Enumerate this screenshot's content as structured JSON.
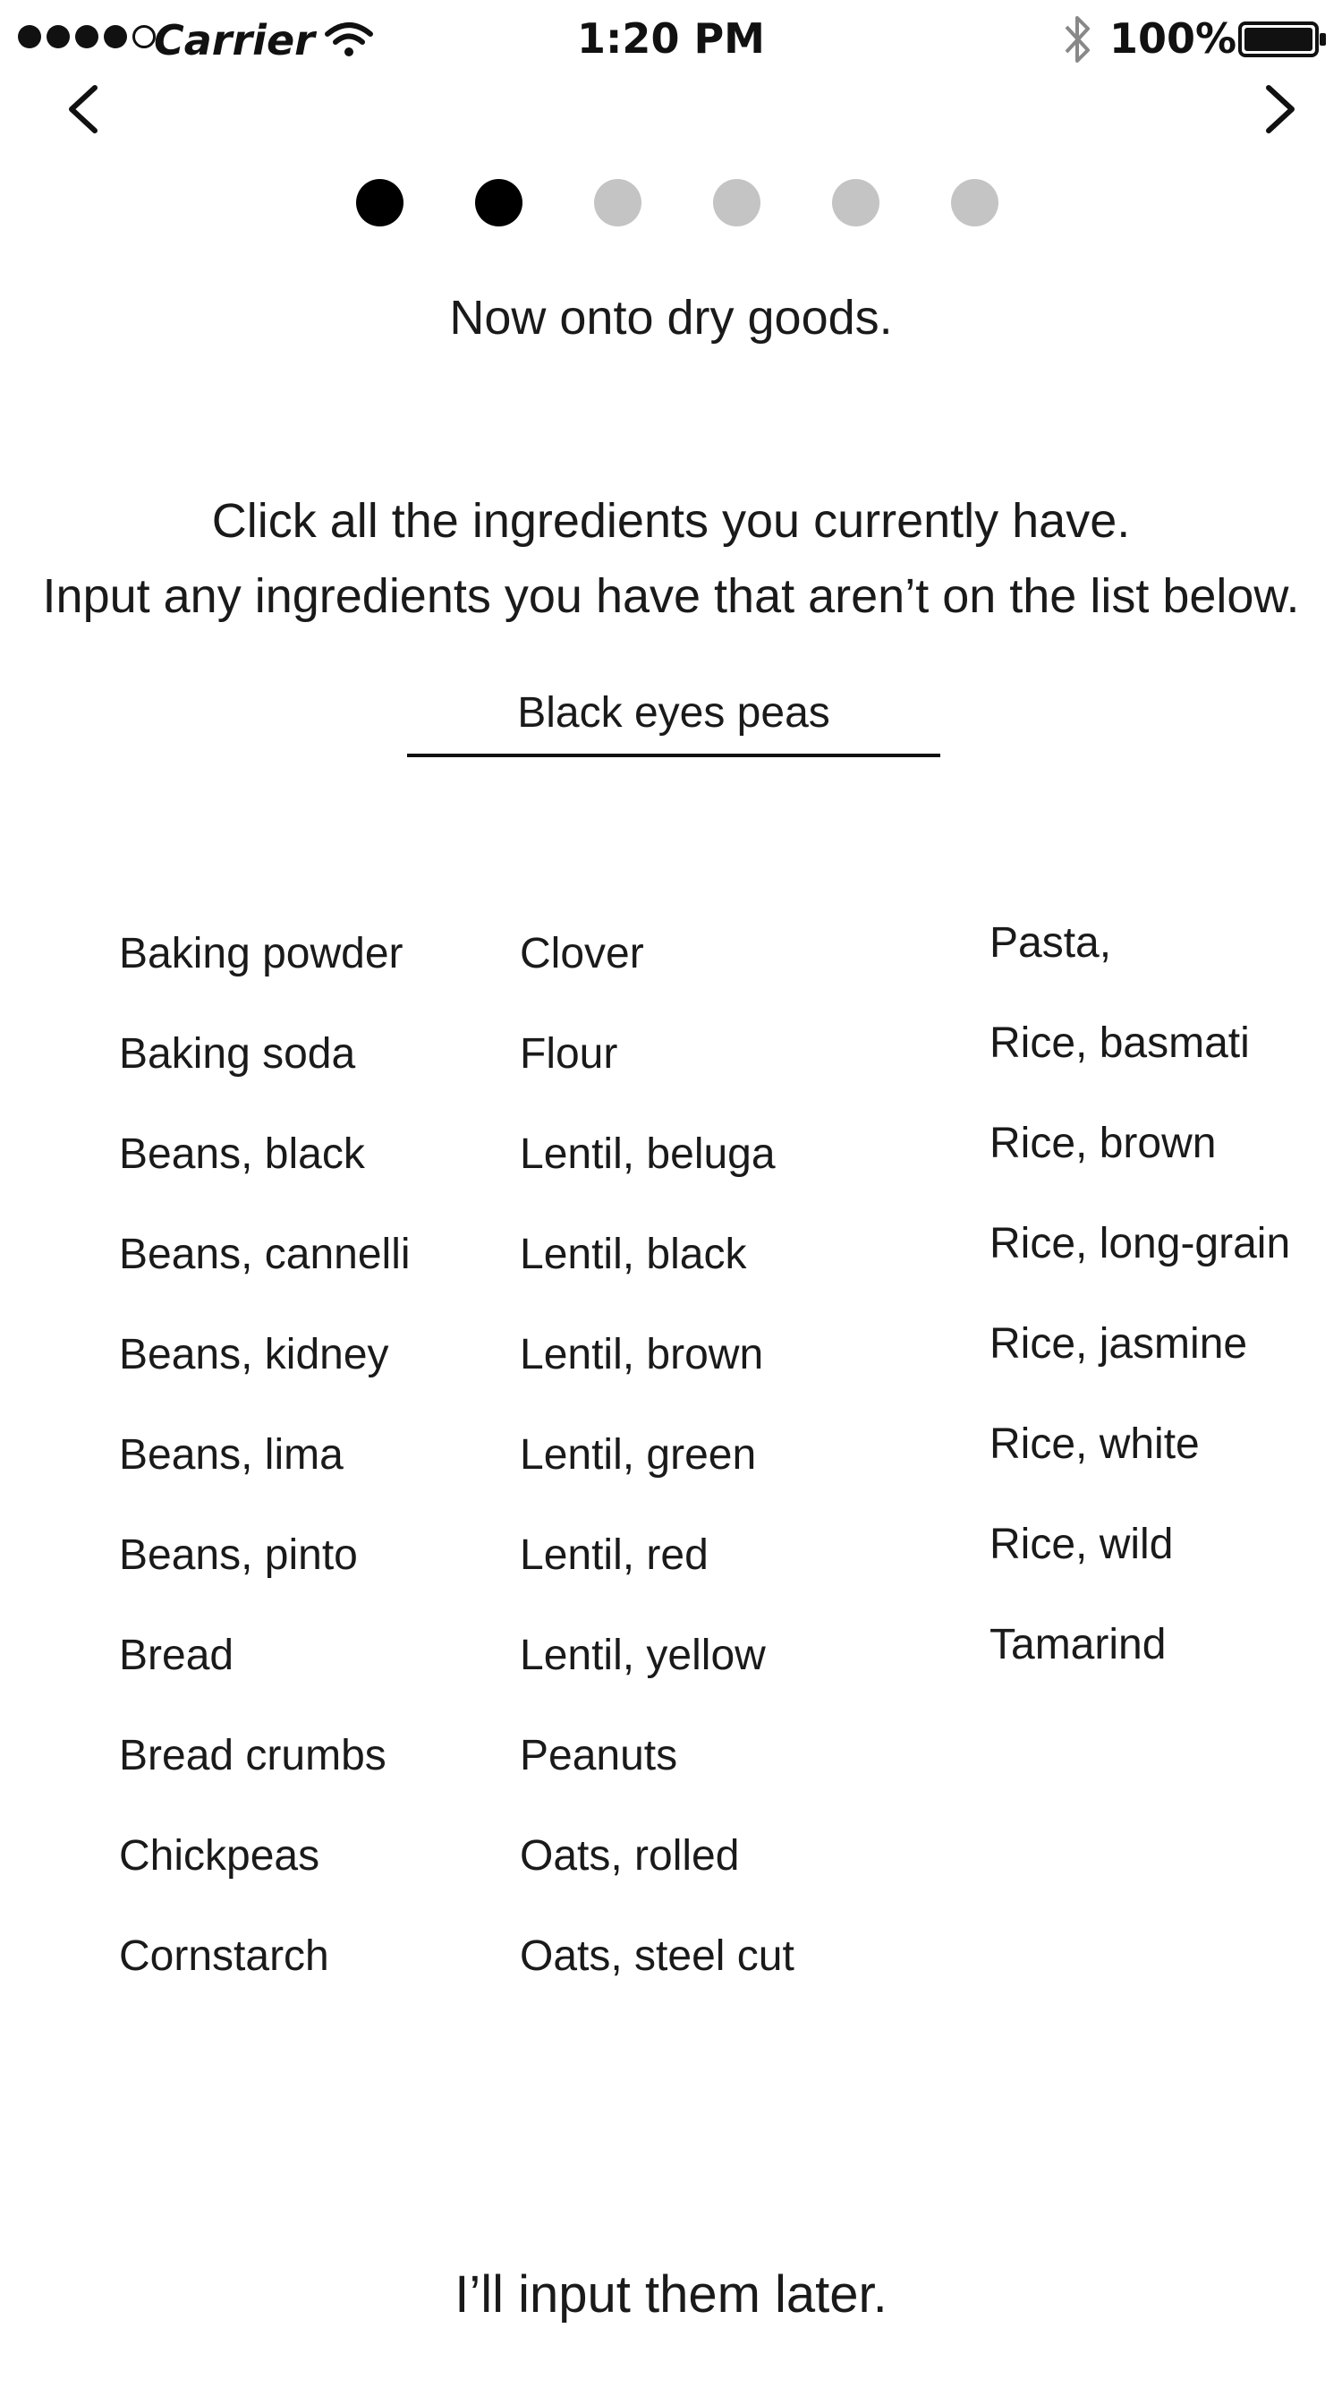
{
  "status_bar": {
    "signal_icon": "signal-dots-icon",
    "carrier": "Carrier",
    "wifi_icon": "wifi-icon",
    "time": "1:20 PM",
    "bluetooth_icon": "bluetooth-icon",
    "battery_percent": "100%",
    "battery_icon": "battery-icon"
  },
  "nav": {
    "back_icon": "chevron-left-icon",
    "forward_icon": "chevron-right-icon"
  },
  "pager": {
    "total": 6,
    "current": 2,
    "active_color": "#000000",
    "inactive_color": "#c4c4c4"
  },
  "heading": "Now onto dry goods.",
  "instructions": {
    "line1": "Click all the ingredients you currently have.",
    "line2": "Input any ingredients you have that aren’t on the list below."
  },
  "input": {
    "value": "Black eyes peas"
  },
  "ingredients": {
    "col1": [
      "Baking powder",
      "Baking soda",
      "Beans, black",
      "Beans, cannelli",
      "Beans, kidney",
      "Beans, lima",
      "Beans, pinto",
      "Bread",
      "Bread crumbs",
      "Chickpeas",
      "Cornstarch"
    ],
    "col2": [
      "Clover",
      "Flour",
      "Lentil, beluga",
      "Lentil, black",
      "Lentil, brown",
      "Lentil, green",
      "Lentil, red",
      "Lentil, yellow",
      "Peanuts",
      "Oats, rolled",
      "Oats, steel cut"
    ],
    "col3": [
      "Pasta,",
      "Rice, basmati",
      "Rice, brown",
      "Rice, long-grain",
      "Rice, jasmine",
      "Rice, white",
      "Rice, wild",
      "Tamarind"
    ]
  },
  "later_link": "I’ll input them later."
}
